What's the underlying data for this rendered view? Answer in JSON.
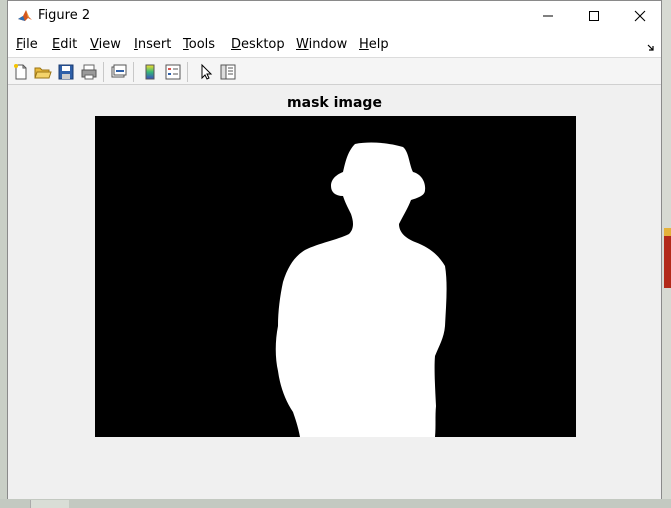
{
  "window": {
    "title": "Figure 2",
    "controls": [
      "minimize",
      "maximize",
      "close"
    ]
  },
  "menu": {
    "items": [
      {
        "label_pre": "",
        "mnemonic": "F",
        "label_post": "ile"
      },
      {
        "label_pre": "",
        "mnemonic": "E",
        "label_post": "dit"
      },
      {
        "label_pre": "",
        "mnemonic": "V",
        "label_post": "iew"
      },
      {
        "label_pre": "",
        "mnemonic": "I",
        "label_post": "nsert"
      },
      {
        "label_pre": "",
        "mnemonic": "T",
        "label_post": "ools"
      },
      {
        "label_pre": "",
        "mnemonic": "D",
        "label_post": "esktop"
      },
      {
        "label_pre": "",
        "mnemonic": "W",
        "label_post": "indow"
      },
      {
        "label_pre": "",
        "mnemonic": "H",
        "label_post": "elp"
      }
    ]
  },
  "toolbar": {
    "buttons": [
      "new-figure-icon",
      "open-file-icon",
      "save-figure-icon",
      "print-figure-icon",
      "link-plot-icon",
      "insert-colorbar-icon",
      "insert-legend-icon",
      "edit-plot-icon",
      "property-inspector-icon"
    ]
  },
  "figure": {
    "title": "mask image"
  },
  "colors": {
    "mask_background": "#000000",
    "mask_foreground": "#ffffff",
    "figure_background": "#f0f0f0"
  }
}
